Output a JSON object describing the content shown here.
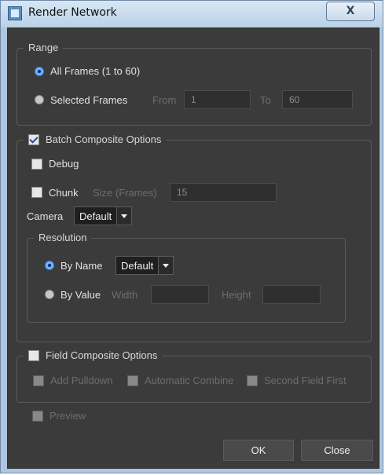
{
  "window": {
    "title": "Render Network",
    "close_glyph": "X"
  },
  "range": {
    "legend": "Range",
    "all_frames": {
      "label": "All Frames (1 to 60)",
      "checked": true
    },
    "selected_frames": {
      "label": "Selected Frames",
      "checked": false,
      "from_label": "From",
      "from_value": "1",
      "to_label": "To",
      "to_value": "60"
    }
  },
  "batch": {
    "legend": "Batch Composite Options",
    "enabled": true,
    "debug": {
      "label": "Debug",
      "checked": false
    },
    "chunk": {
      "label": "Chunk",
      "checked": false,
      "size_label": "Size (Frames)",
      "size_value": "15"
    },
    "camera": {
      "label": "Camera",
      "value": "Default"
    },
    "resolution": {
      "legend": "Resolution",
      "by_name": {
        "label": "By Name",
        "checked": true,
        "value": "Default"
      },
      "by_value": {
        "label": "By Value",
        "checked": false,
        "width_label": "Width",
        "width_value": "",
        "height_label": "Height",
        "height_value": ""
      }
    }
  },
  "field_composite": {
    "legend": "Field Composite Options",
    "enabled": false,
    "add_pulldown": "Add Pulldown",
    "automatic_combine": "Automatic Combine",
    "second_field_first": "Second Field First"
  },
  "preview": {
    "label": "Preview",
    "checked": false
  },
  "buttons": {
    "ok": "OK",
    "close": "Close"
  }
}
